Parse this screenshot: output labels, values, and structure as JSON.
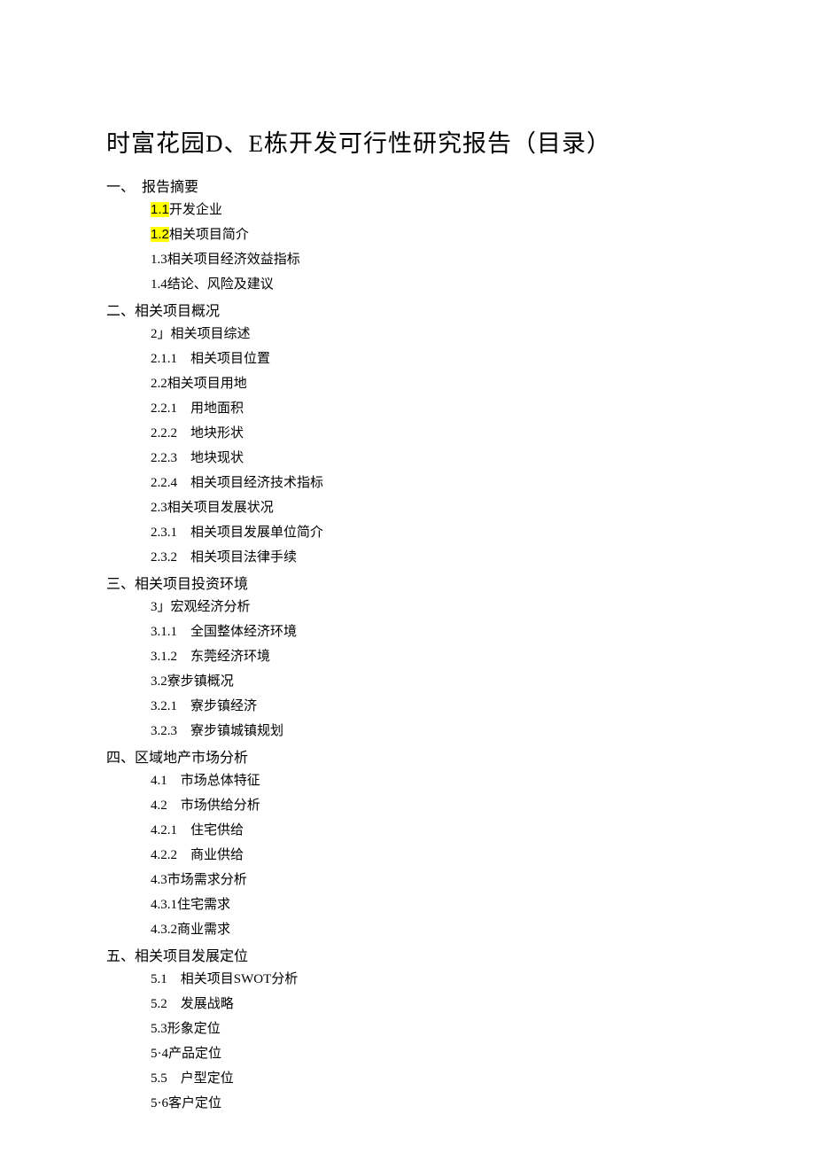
{
  "title": "时富花园D、E栋开发可行性研究报告（目录）",
  "sections": {
    "s1": {
      "header": "一、　报告摘要",
      "items": {
        "i1_prefix": "1.1",
        "i1_text": "开发企业",
        "i2_prefix": "1.2",
        "i2_text": "相关项目简介",
        "i3": "1.3相关项目经济效益指标",
        "i4": "1.4结论、风险及建议"
      }
    },
    "s2": {
      "header": "二、相关项目概况",
      "items": {
        "i1": "2」相关项目综述",
        "i2": "2.1.1　相关项目位置",
        "i3": "2.2相关项目用地",
        "i4": "2.2.1　用地面积",
        "i5": "2.2.2　地块形状",
        "i6": "2.2.3　地块现状",
        "i7": "2.2.4　相关项目经济技术指标",
        "i8": "2.3相关项目发展状况",
        "i9": "2.3.1　相关项目发展单位简介",
        "i10": "2.3.2　相关项目法律手续"
      }
    },
    "s3": {
      "header": "三、相关项目投资环境",
      "items": {
        "i1": "3」宏观经济分析",
        "i2": "3.1.1　全国整体经济环境",
        "i3": "3.1.2　东莞经济环境",
        "i4": "3.2寮步镇概况",
        "i5": "3.2.1　寮步镇经济",
        "i6": "3.2.3　寮步镇城镇规划"
      }
    },
    "s4": {
      "header": "四、区域地产市场分析",
      "items": {
        "i1": "4.1　市场总体特征",
        "i2": "4.2　市场供给分析",
        "i3": "4.2.1　住宅供给",
        "i4": "4.2.2　商业供给",
        "i5": "4.3市场需求分析",
        "i6": "4.3.1住宅需求",
        "i7": "4.3.2商业需求"
      }
    },
    "s5": {
      "header": "五、相关项目发展定位",
      "items": {
        "i1": "5.1　相关项目SWOT分析",
        "i2": "5.2　发展战略",
        "i3": "5.3形象定位",
        "i4": "5·4产品定位",
        "i5": "5.5　户型定位",
        "i6": "5·6客户定位"
      }
    }
  }
}
